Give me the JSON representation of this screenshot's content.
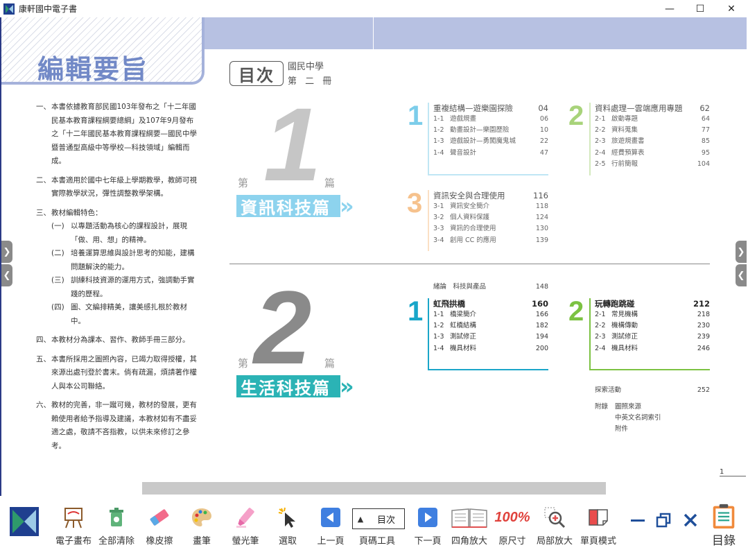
{
  "window": {
    "title": "康軒國中電子書",
    "minimize": "—",
    "maximize": "☐",
    "close": "✕"
  },
  "page_left": {
    "title": "編輯要旨",
    "items": [
      {
        "n": "一、",
        "t": "本書依據教育部民國103年發布之「十二年國民基本教育課程綱要總綱」及107年9月發布之「十二年國民基本教育課程綱要—國民中學暨普通型高級中等學校—科技領域」編輯而成。"
      },
      {
        "n": "二、",
        "t": "本書適用於國中七年級上學期教學，教師可視實際教學狀況，彈性調整教學架構。"
      },
      {
        "n": "三、",
        "t": "教材編輯特色："
      },
      {
        "n": "四、",
        "t": "本教材分為課本、習作、教師手冊三部分。"
      },
      {
        "n": "五、",
        "t": "本書所採用之圖照內容，已竭力取得授權，其來源出處刊登於書末。倘有疏漏，煩請著作權人與本公司聯絡。"
      },
      {
        "n": "六、",
        "t": "教材的完善，非一蹴可幾，教材的發展，更有賴使用者給予指導及建議，本教材如有不盡妥適之處，敬請不吝指教，以供未來修訂之參考。"
      }
    ],
    "features": [
      {
        "n": "(一)",
        "t": "以專題活動為核心的課程設計，展現「做、用、想」的精神。"
      },
      {
        "n": "(二)",
        "t": "培養運算思維與設計思考的知能，建構問題解決的能力。"
      },
      {
        "n": "(三)",
        "t": "訓練科技資源的運用方式，強調動手實踐的歷程。"
      },
      {
        "n": "(四)",
        "t": "圖、文編排精美，讓美感扎根於教材中。"
      }
    ]
  },
  "toc": {
    "heading": "目次",
    "school": "國民中學",
    "volume": "第 二 冊",
    "part_prefix": "第",
    "part_suffix": "篇",
    "part1": {
      "num": "1",
      "name": "資訊科技篇",
      "units": [
        {
          "num": "1",
          "title": "重複結構—遊樂園探險",
          "page": "04",
          "rows": [
            [
              "1-1",
              "遊戲規畫",
              "06"
            ],
            [
              "1-2",
              "動畫設計—樂園歷險",
              "10"
            ],
            [
              "1-3",
              "遊戲設計—勇闖魔鬼城",
              "22"
            ],
            [
              "1-4",
              "聲音設計",
              "47"
            ]
          ]
        },
        {
          "num": "2",
          "title": "資料處理—雲端應用專題",
          "page": "62",
          "rows": [
            [
              "2-1",
              "啟動專題",
              "64"
            ],
            [
              "2-2",
              "資料蒐集",
              "77"
            ],
            [
              "2-3",
              "旅遊規畫書",
              "85"
            ],
            [
              "2-4",
              "經費預算表",
              "95"
            ],
            [
              "2-5",
              "行前簡報",
              "104"
            ]
          ]
        },
        {
          "num": "3",
          "title": "資訊安全與合理使用",
          "page": "116",
          "rows": [
            [
              "3-1",
              "資訊安全簡介",
              "118"
            ],
            [
              "3-2",
              "個人資料保護",
              "124"
            ],
            [
              "3-3",
              "資訊的合理使用",
              "130"
            ],
            [
              "3-4",
              "創用 CC 的應用",
              "139"
            ]
          ]
        }
      ]
    },
    "part2": {
      "num": "2",
      "name": "生活科技篇",
      "intro": {
        "label": "緒論　科技與產品",
        "page": "148"
      },
      "units": [
        {
          "num": "1",
          "title": "虹飛拱橋",
          "page": "160",
          "rows": [
            [
              "1-1",
              "橋梁簡介",
              "166"
            ],
            [
              "1-2",
              "虹橋結構",
              "182"
            ],
            [
              "1-3",
              "測試修正",
              "194"
            ],
            [
              "1-4",
              "機具材料",
              "200"
            ]
          ]
        },
        {
          "num": "2",
          "title": "玩轉跑跳碰",
          "page": "212",
          "rows": [
            [
              "2-1",
              "常見機構",
              "218"
            ],
            [
              "2-2",
              "機構傳動",
              "230"
            ],
            [
              "2-3",
              "測試修正",
              "239"
            ],
            [
              "2-4",
              "機具材料",
              "246"
            ]
          ]
        }
      ],
      "explore": {
        "label": "探索活動",
        "page": "252"
      },
      "appendix_label": "附錄",
      "appendix": [
        "圖照來源",
        "中英文名詞索引",
        "附件"
      ]
    },
    "page_number": "1"
  },
  "toolbar": {
    "draw_board": "電子畫布",
    "clear_all": "全部清除",
    "eraser": "橡皮擦",
    "brush": "畫筆",
    "highlighter": "螢光筆",
    "select": "選取",
    "prev_page": "上一頁",
    "page_tool": "頁碼工具",
    "page_value": "目次",
    "next_page": "下一頁",
    "four_corner": "四角放大",
    "original_size": "原尺寸",
    "zoom_label": "100%",
    "local_zoom": "局部放大",
    "single_page": "單頁模式",
    "catalog": "目錄"
  },
  "side": {
    "next": "❯",
    "prev": "❮"
  },
  "colors": {
    "band": "#b7c1e2",
    "title_blue": "#7289c7",
    "part1": "#8dd3ee",
    "part2": "#2bb3b5",
    "unit_green": "#a8d37a",
    "unit_orange": "#f6c28d",
    "unit_blue": "#7ccdea"
  }
}
